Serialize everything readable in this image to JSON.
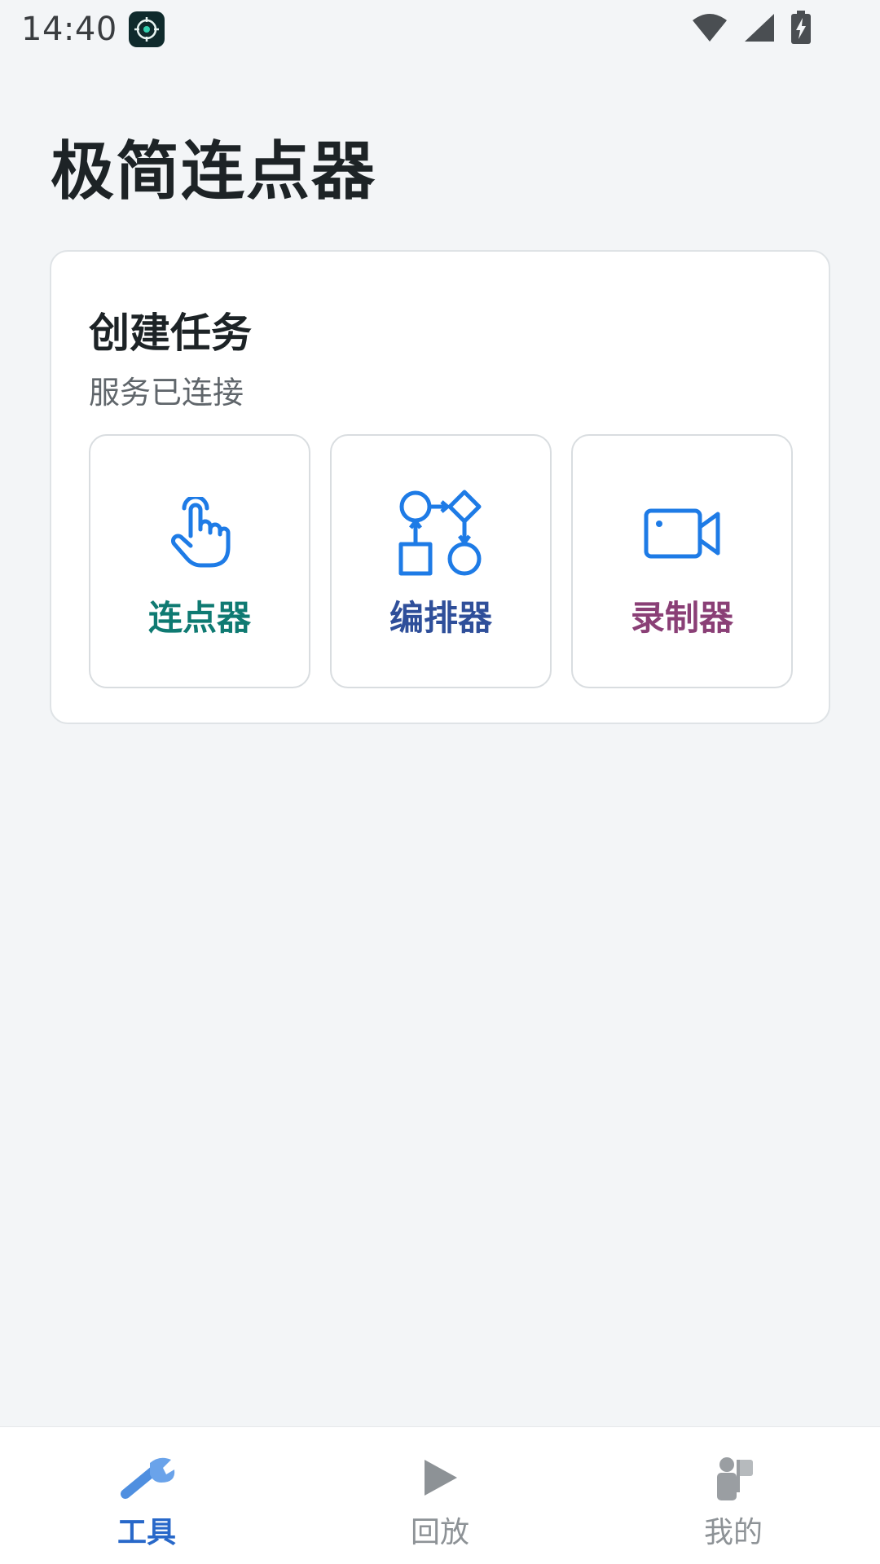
{
  "status_bar": {
    "time": "14:40"
  },
  "app": {
    "title": "极简连点器"
  },
  "create_task": {
    "title": "创建任务",
    "subtitle": "服务已连接",
    "tiles": [
      {
        "label": "连点器",
        "icon": "tap-hand-icon",
        "color": "#0f7a72"
      },
      {
        "label": "编排器",
        "icon": "flowchart-icon",
        "color": "#2f4f9a"
      },
      {
        "label": "录制器",
        "icon": "video-camera-icon",
        "color": "#8a3f76"
      }
    ]
  },
  "bottom_nav": {
    "items": [
      {
        "label": "工具",
        "icon": "wrench-icon",
        "active": true,
        "color": "#2868c9"
      },
      {
        "label": "回放",
        "icon": "play-icon",
        "active": false,
        "color": "#8d9296"
      },
      {
        "label": "我的",
        "icon": "person-icon",
        "active": false,
        "color": "#8d9296"
      }
    ]
  },
  "colors": {
    "background": "#f3f5f7",
    "icon_blue": "#1e7be6"
  }
}
